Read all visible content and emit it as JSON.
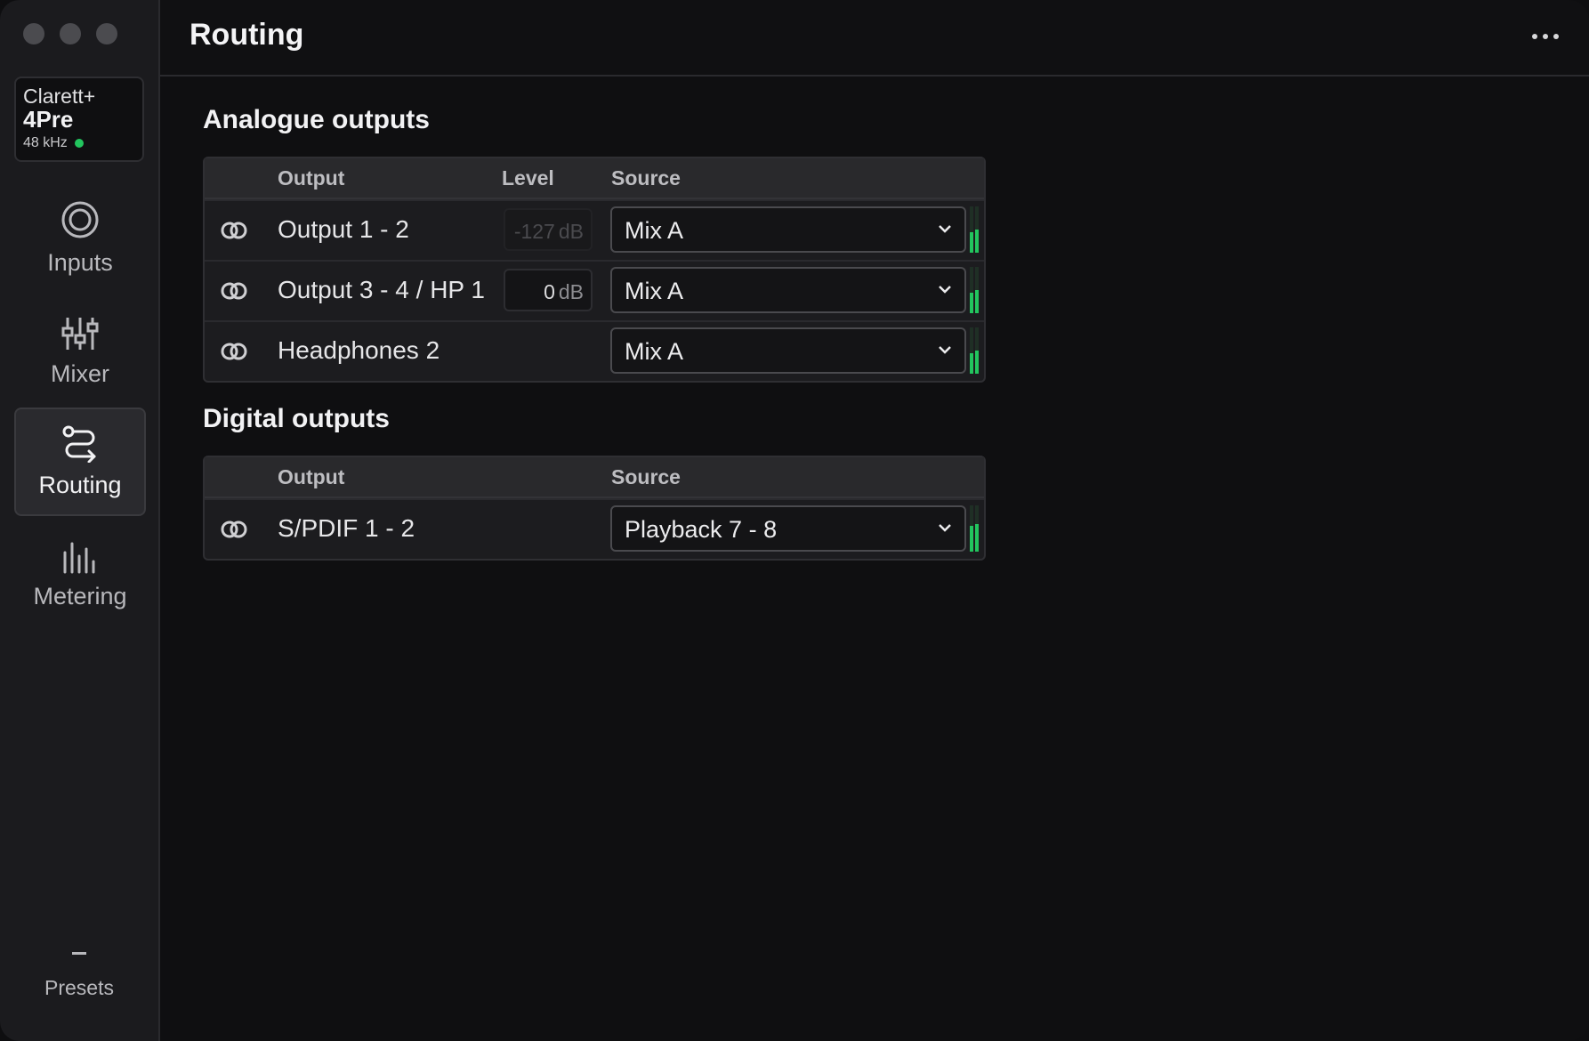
{
  "window": {
    "title": "Routing",
    "menu_icon": "more-horizontal-icon"
  },
  "device": {
    "brand": "Clarett+",
    "model": "4Pre",
    "sample_rate": "48 kHz",
    "status_color": "#22c55e"
  },
  "nav": {
    "items": [
      {
        "label": "Inputs",
        "icon": "inputs-icon",
        "active": false
      },
      {
        "label": "Mixer",
        "icon": "mixer-icon",
        "active": false
      },
      {
        "label": "Routing",
        "icon": "routing-icon",
        "active": true
      },
      {
        "label": "Metering",
        "icon": "metering-icon",
        "active": false
      }
    ],
    "presets_label": "Presets"
  },
  "analogue": {
    "title": "Analogue outputs",
    "headers": {
      "output": "Output",
      "level": "Level",
      "source": "Source"
    },
    "rows": [
      {
        "output": "Output 1 - 2",
        "level": "-127",
        "unit": "dB",
        "level_enabled": false,
        "source": "Mix A",
        "meter": [
          0.45,
          0.5
        ]
      },
      {
        "output": "Output 3 - 4 / HP 1",
        "level": "0",
        "unit": "dB",
        "level_enabled": true,
        "source": "Mix A",
        "meter": [
          0.45,
          0.5
        ]
      },
      {
        "output": "Headphones 2",
        "source": "Mix A",
        "meter": [
          0.45,
          0.5
        ]
      }
    ]
  },
  "digital": {
    "title": "Digital outputs",
    "headers": {
      "output": "Output",
      "source": "Source"
    },
    "rows": [
      {
        "output": "S/PDIF 1 - 2",
        "source": "Playback 7 - 8",
        "meter": [
          0.55,
          0.6
        ]
      }
    ]
  },
  "colors": {
    "accent_meter": "#22c55e",
    "background": "#0f0f11",
    "sidebar": "#1b1b1e"
  }
}
